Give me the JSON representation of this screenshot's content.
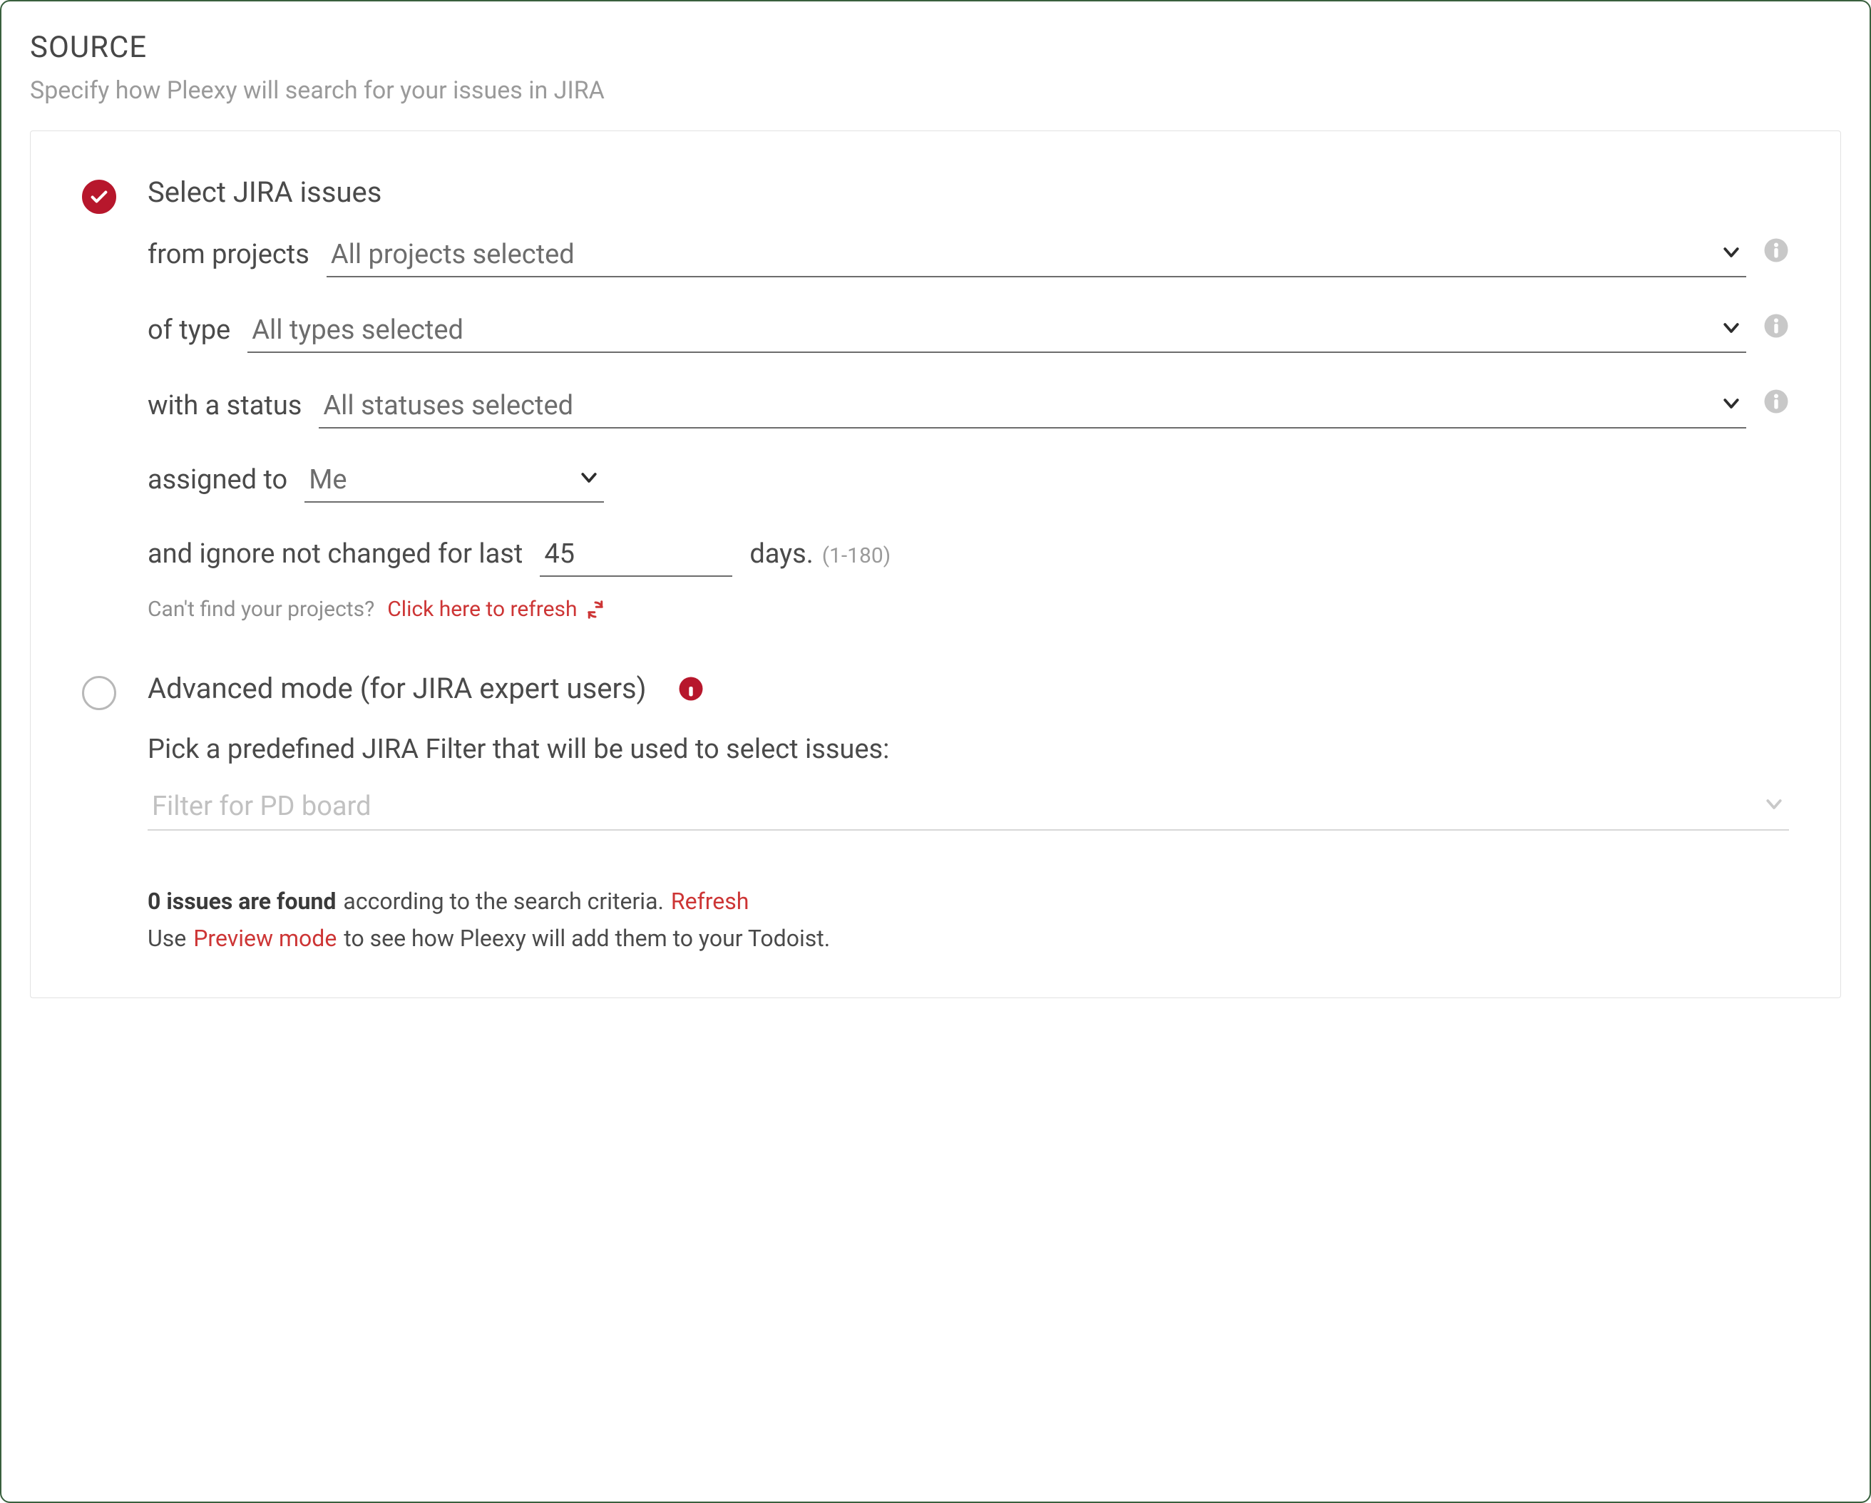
{
  "section": {
    "title": "SOURCE",
    "subtitle": "Specify how Pleexy will search for your issues in JIRA"
  },
  "simple": {
    "title": "Select JIRA issues",
    "rows": {
      "projects_label": "from projects",
      "projects_value": "All projects selected",
      "type_label": "of type",
      "type_value": "All types selected",
      "status_label": "with a status",
      "status_value": "All statuses selected",
      "assigned_label": "assigned to",
      "assigned_value": "Me",
      "ignore_prefix": "and ignore not changed for last",
      "ignore_value": "45",
      "ignore_suffix": "days.",
      "ignore_hint": "(1-180)"
    },
    "refresh": {
      "prompt": "Can't find your projects?",
      "link": "Click here to refresh"
    }
  },
  "advanced": {
    "title": "Advanced mode (for JIRA expert users)",
    "desc": "Pick a predefined JIRA Filter that will be used to select issues:",
    "filter_value": "Filter for PD board"
  },
  "footer": {
    "found_bold": "0 issues are found",
    "found_rest": "according to the search criteria.",
    "refresh": "Refresh",
    "use_prefix": "Use",
    "preview_link": "Preview mode",
    "use_suffix": "to see how Pleexy will add them to your Todoist."
  }
}
